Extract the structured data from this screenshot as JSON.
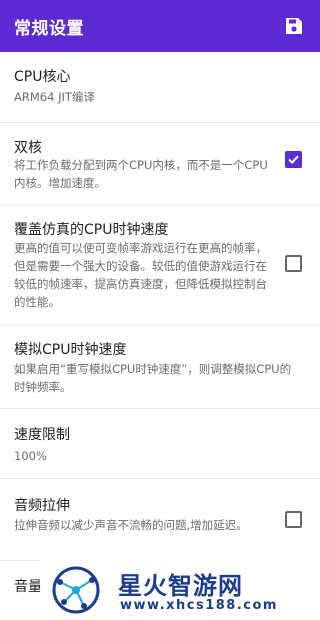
{
  "appbar": {
    "title": "常规设置",
    "save_icon": "save-icon"
  },
  "settings": [
    {
      "title": "CPU核心",
      "subtitle": "ARM64 JIT编译"
    },
    {
      "title": "双核",
      "subtitle": "将工作负载分配到两个CPU内核，而不是一个CPU内核。增加速度。",
      "checked": true
    },
    {
      "title": "覆盖仿真的CPU时钟速度",
      "subtitle": "更高的值可以使可变帧率游戏运行在更高的帧率，但是需要一个强大的设备。较低的值使游戏运行在较低的帧速率，提高仿真速度，但降低模拟控制台的性能。",
      "checked": false
    },
    {
      "title": "模拟CPU时钟速度",
      "subtitle": "如果启用“重写模拟CPU时钟速度”，则调整模拟CPU的时钟频率。"
    },
    {
      "title": "速度限制",
      "subtitle": "100%"
    },
    {
      "title": "音频拉伸",
      "subtitle": "拉伸音频以减少声音不流畅的问题,增加延迟。",
      "checked": false
    },
    {
      "title": "音量"
    }
  ],
  "watermark": {
    "title": "星火智游网",
    "url": "www.xhcs188.com"
  },
  "colors": {
    "accent": "#5d2ad3",
    "divider": "#e6e6e6"
  }
}
